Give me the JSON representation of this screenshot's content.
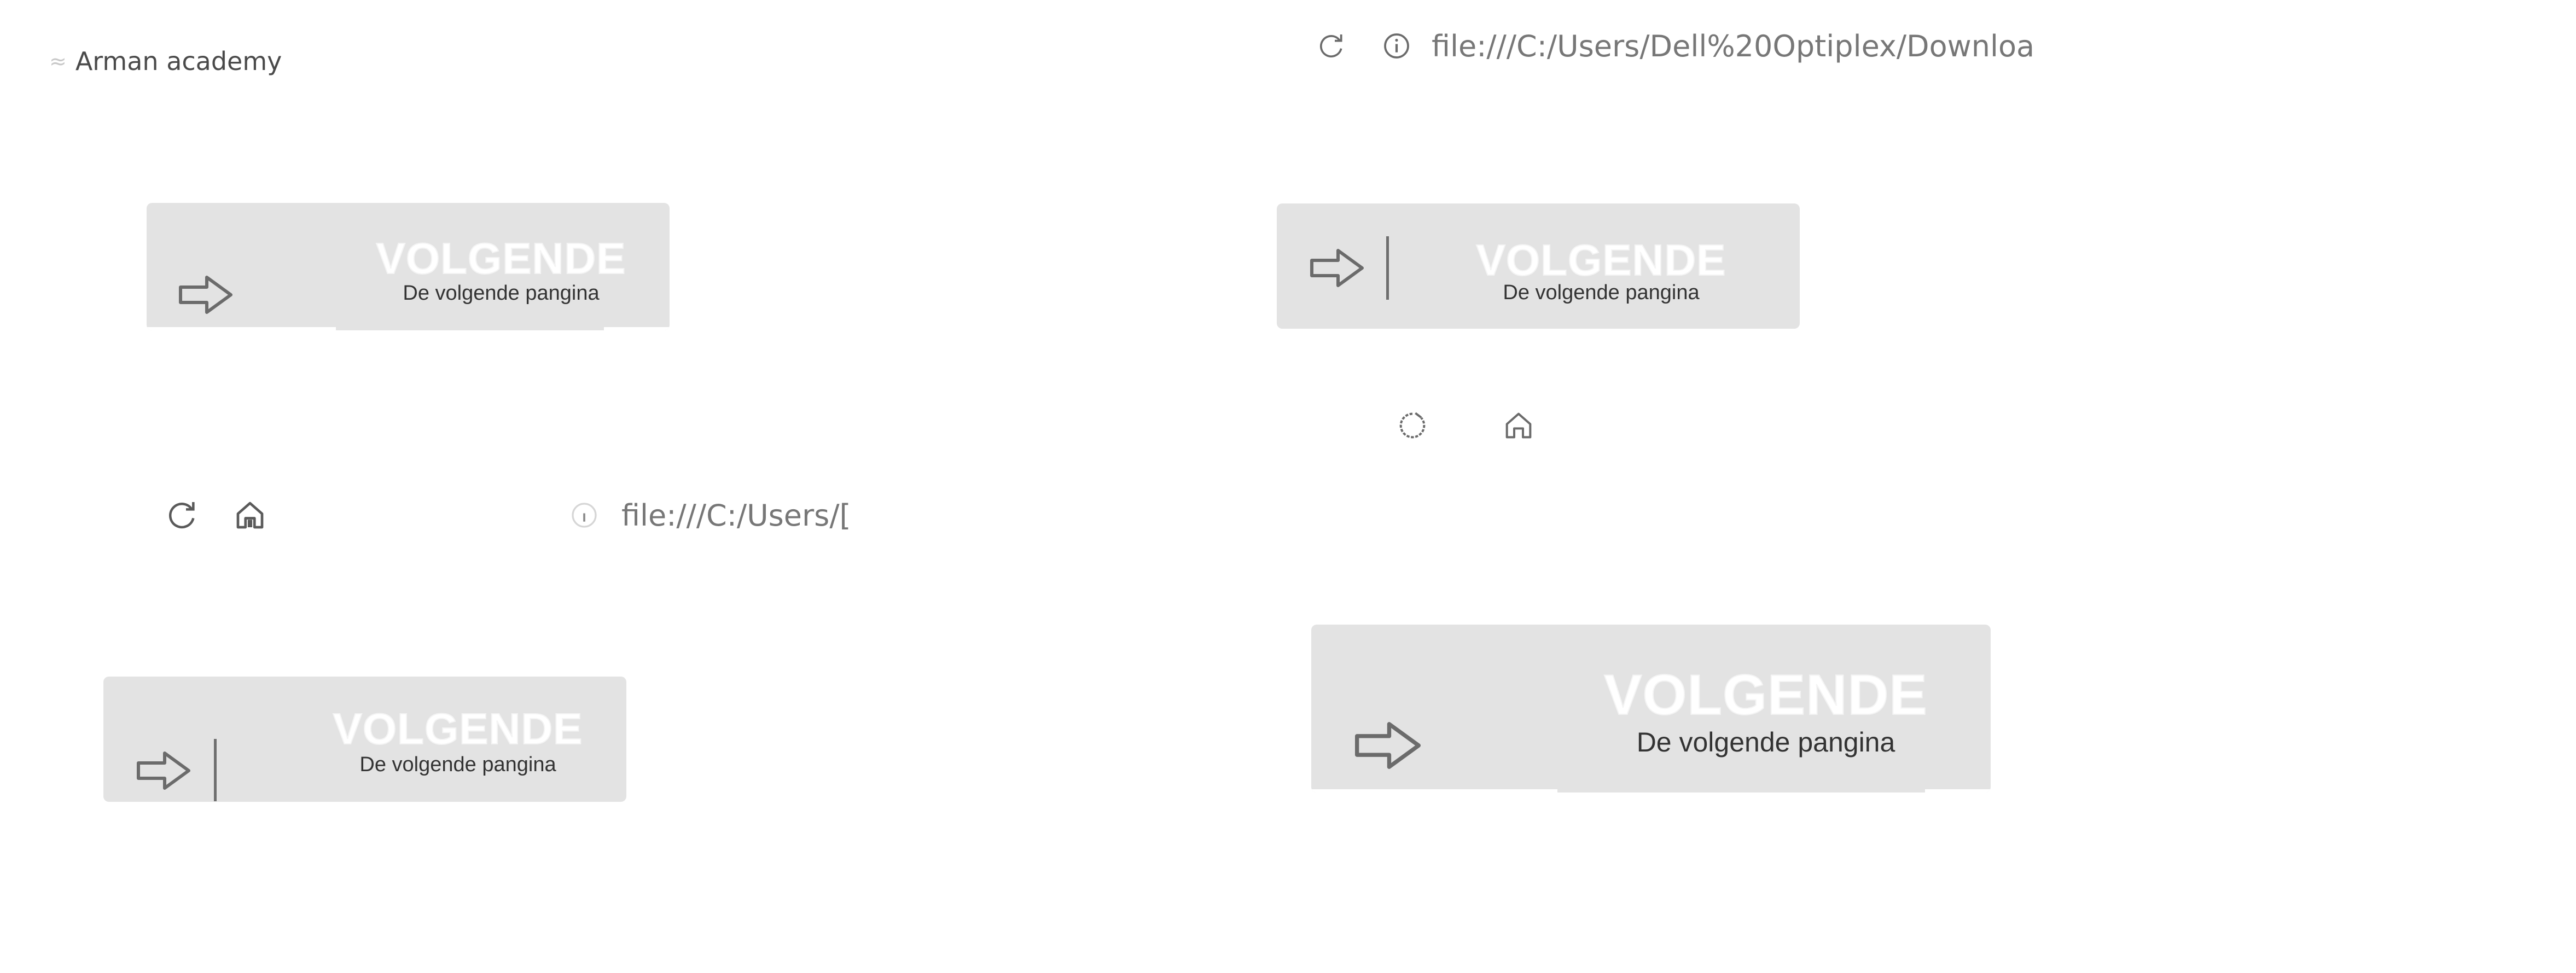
{
  "tab": {
    "title": "Arman academy",
    "icon": "globe-icon"
  },
  "address_bar_top": {
    "url": "file:///C:/Users/Dell%20Optiplex/Downloa",
    "icons": [
      "reload-icon",
      "info-icon"
    ]
  },
  "address_bar_middle": {
    "url": "file:///C:/Users/[",
    "icons": [
      "reload-icon",
      "home-icon",
      "info-icon"
    ]
  },
  "nav_icons_right": {
    "icons": [
      "loading-icon",
      "home-icon"
    ]
  },
  "buttons": [
    {
      "title": "VOLGENDE",
      "subtitle": "De volgende pangina",
      "icon": "arrow-right-icon"
    },
    {
      "title": "VOLGENDE",
      "subtitle": "De volgende pangina",
      "icon": "arrow-right-icon"
    },
    {
      "title": "VOLGENDE",
      "subtitle": "De volgende pangina",
      "icon": "arrow-right-icon"
    },
    {
      "title": "VOLGENDE",
      "subtitle": "De volgende pangina",
      "icon": "arrow-right-icon"
    }
  ],
  "colors": {
    "button_bg": "#e3e3e3",
    "title_text": "#ffffff",
    "subtitle_text": "#333333",
    "icon": "#6b6b6b"
  }
}
